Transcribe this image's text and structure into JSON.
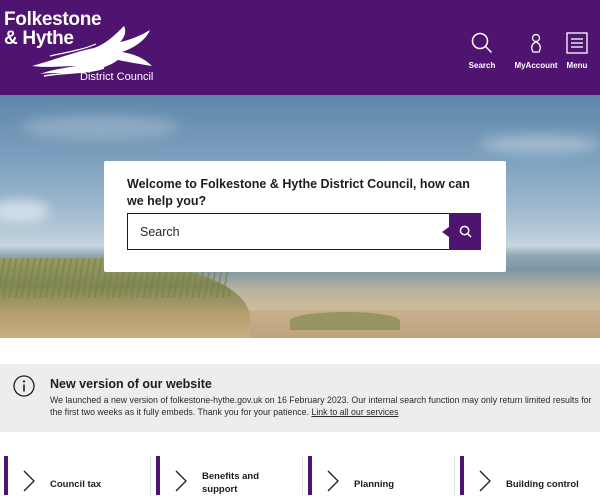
{
  "header": {
    "logo": {
      "line1": "Folkestone",
      "line2": "& Hythe",
      "subtitle": "District Council"
    },
    "nav": [
      {
        "label": "Search",
        "icon": "search-icon"
      },
      {
        "label": "MyAccount",
        "icon": "user-icon"
      },
      {
        "label": "Menu",
        "icon": "menu-icon"
      }
    ],
    "brand_color": "#4f1470"
  },
  "search": {
    "title": "Welcome to Folkestone & Hythe District Council, how can we help you?",
    "placeholder": "Search",
    "button_icon": "search-icon"
  },
  "notice": {
    "icon": "info-icon",
    "title": "New version of our website",
    "body": "We launched a new version of folkestone-hythe.gov.uk on 16 February 2023. Our internal search function may only return limited results for the first two weeks as it fully embeds. Thank you for your patience.",
    "link": "Link to all our services"
  },
  "services": [
    {
      "label": "Council tax"
    },
    {
      "label": "Benefits and support"
    },
    {
      "label": "Planning"
    },
    {
      "label": "Building control"
    }
  ]
}
